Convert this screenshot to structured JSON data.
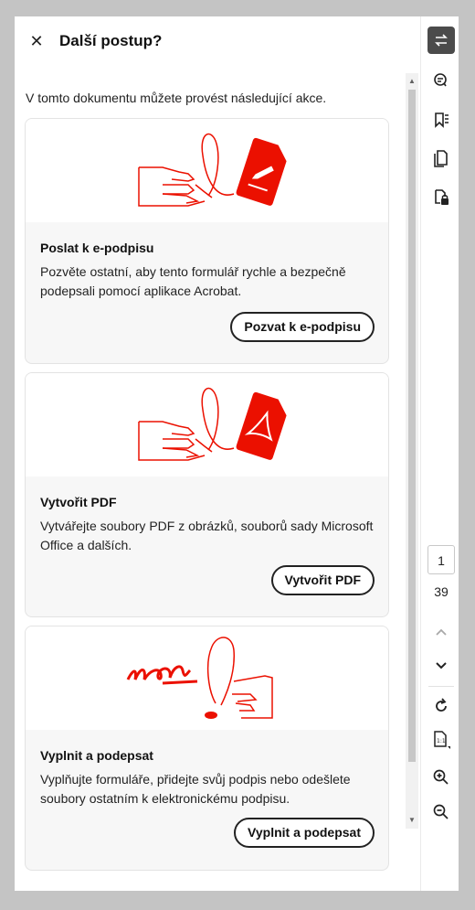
{
  "panel": {
    "title": "Další postup?",
    "intro": "V tomto dokumentu můžete provést následující akce."
  },
  "cards": [
    {
      "title": "Poslat k e-podpisu",
      "description": "Pozvěte ostatní, aby tento formulář rychle a bezpečně podepsali pomocí aplikace Acrobat.",
      "button": "Pozvat k e-podpisu"
    },
    {
      "title": "Vytvořit PDF",
      "description": "Vytvářejte soubory PDF z obrázků, souborů sady Microsoft Office a dalších.",
      "button": "Vytvořit PDF"
    },
    {
      "title": "Vyplnit a podepsat",
      "description": "Vyplňujte formuláře, přidejte svůj podpis nebo odešlete soubory ostatním k elektronickému podpisu.",
      "button": "Vyplnit a podepsat"
    }
  ],
  "rail": {
    "current_page": "1",
    "total_pages": "39",
    "icons": [
      "convert-icon",
      "comment-icon",
      "bookmark-icon",
      "pages-icon",
      "protect-icon",
      "page-up-icon",
      "page-down-icon",
      "refresh-icon",
      "fit-page-icon",
      "zoom-in-icon",
      "zoom-out-icon"
    ]
  },
  "colors": {
    "accent_red": "#eb1000",
    "active_rail": "#4b4b4b"
  }
}
